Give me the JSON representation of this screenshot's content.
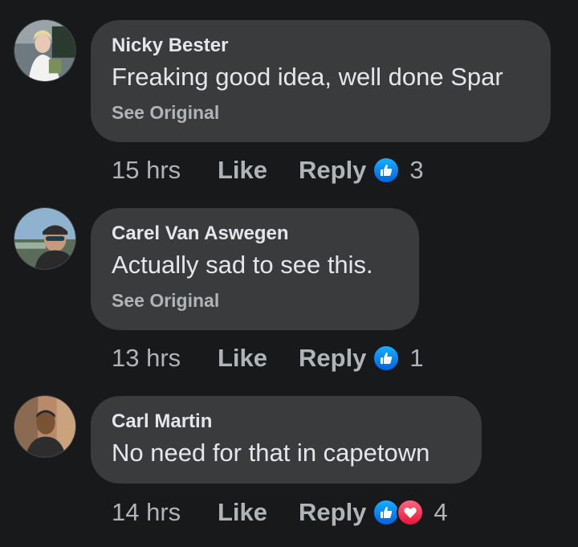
{
  "comments": [
    {
      "author": "Nicky Bester",
      "text": "Freaking good idea, well done Spar",
      "see_original": "See Original",
      "time": "15 hrs",
      "like_label": "Like",
      "reply_label": "Reply",
      "reactions": [
        "like-icon"
      ],
      "reaction_count": "3"
    },
    {
      "author": "Carel Van Aswegen",
      "text": "Actually sad to see this.",
      "see_original": "See Original",
      "time": "13 hrs",
      "like_label": "Like",
      "reply_label": "Reply",
      "reactions": [
        "like-icon"
      ],
      "reaction_count": "1"
    },
    {
      "author": "Carl Martin",
      "text": "No need for that in capetown",
      "see_original": "",
      "time": "14 hrs",
      "like_label": "Like",
      "reply_label": "Reply",
      "reactions": [
        "like-icon",
        "love-icon"
      ],
      "reaction_count": "4"
    }
  ],
  "colors": {
    "background": "#18191a",
    "bubble": "#3a3b3c",
    "primary_text": "#e4e6eb",
    "secondary_text": "#b0b3b8",
    "like_blue": "#1877f2",
    "love_red": "#f33e58"
  }
}
